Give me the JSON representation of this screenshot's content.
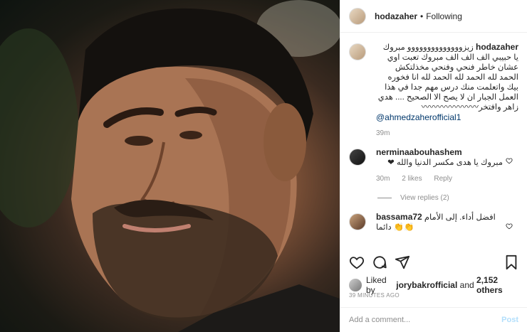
{
  "header": {
    "username": "hodazaher",
    "separator": "•",
    "follow_label": "Following"
  },
  "caption": {
    "username": "hodazaher",
    "text": "زيزوووووووووووووو مبروك يا حبيبي الف الف الف مبروك تعبت اوي عشان خاطر فنحي وفنحي مخذلتكش الحمد لله الحمد لله الحمد لله انا فخوره بيك واتعلمت منك درس مهم جدا في هذا العمل الجبار ان لا يصح الا الصحيح .... هدي زاهر وافتخر〰〰〰〰〰〰〰",
    "mention": "@ahmedzaherofficial1",
    "time": "39m"
  },
  "comments": [
    {
      "username": "nerminaabouhashem",
      "text": "مبروك يا هدى مكسر الدنيا والله ❤",
      "time": "30m",
      "likes": "2 likes",
      "reply_label": "Reply",
      "view_replies": "View replies (2)"
    },
    {
      "username": "bassama72",
      "text": "افضل أداء. إلى الأمام دائما 👏👏"
    }
  ],
  "likes": {
    "prefix": "Liked by",
    "user": "jorybakrofficial",
    "conj": "and",
    "others": "2,152 others"
  },
  "timestamp": "39 MINUTES AGO",
  "add_comment": {
    "placeholder": "Add a comment...",
    "post_label": "Post"
  },
  "icons": {
    "like": "heart-icon",
    "comment": "comment-icon",
    "share": "share-icon",
    "save": "bookmark-icon"
  },
  "colors": {
    "link": "#00376b",
    "post_button": "#b2dffc",
    "secondary_text": "#8e8e8e"
  }
}
